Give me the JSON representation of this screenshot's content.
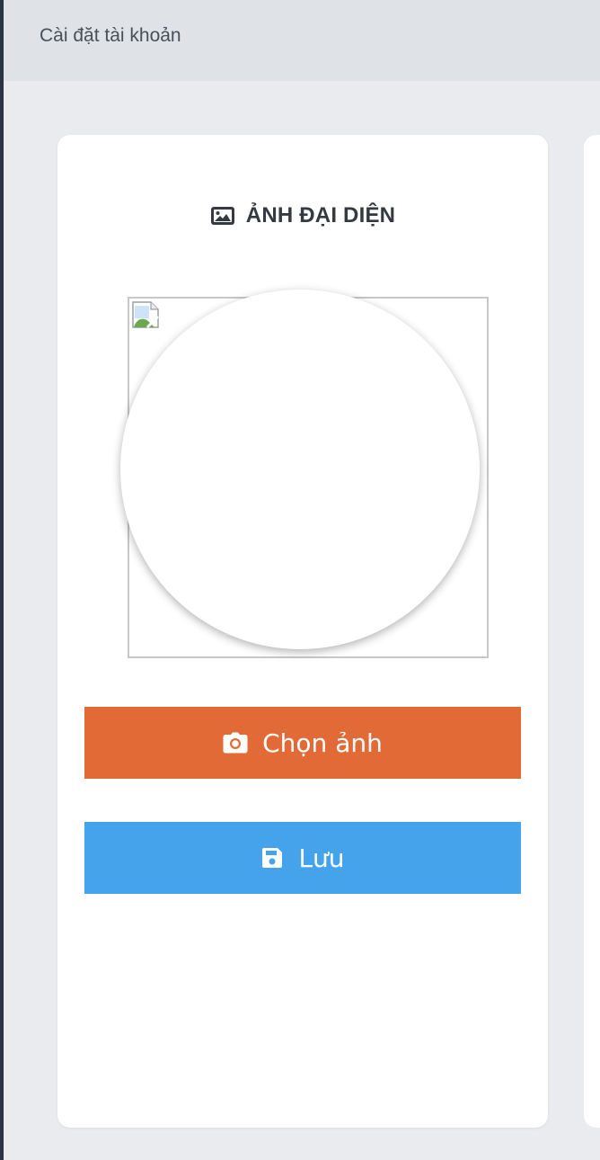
{
  "header": {
    "title": "Cài đặt tài khoản"
  },
  "avatar_card": {
    "title": "ẢNH ĐẠI DIỆN",
    "title_icon": "image-icon",
    "placeholder_icon": "broken-image-icon",
    "choose_button": {
      "label": "Chọn ảnh",
      "icon": "camera-icon",
      "color": "#e26a36"
    },
    "save_button": {
      "label": "Lưu",
      "icon": "save-icon",
      "color": "#45a3ec"
    }
  },
  "colors": {
    "background": "#e9ebee",
    "header_background": "#dfe2e6",
    "card_background": "#ffffff",
    "sidebar_edge": "#2a3444"
  }
}
